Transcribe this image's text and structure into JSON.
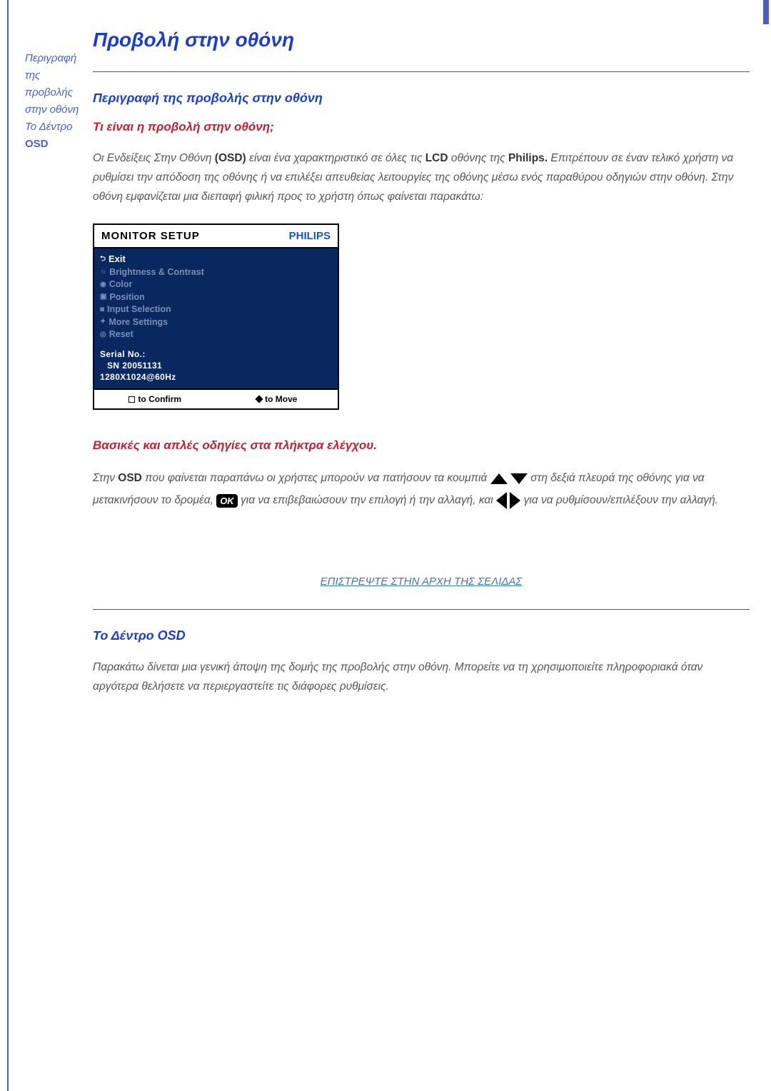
{
  "sidebar": {
    "link1_a": "Περιγραφή",
    "link1_b": "της",
    "link1_c": "προβολής",
    "link1_d": "στην οθόνη",
    "link2_a": "Το Δέντρο",
    "link2_b": "OSD"
  },
  "main": {
    "title": "Προβολή στην οθόνη",
    "desc_heading": "Περιγραφή της προβολής στην οθόνη",
    "what_is_heading": "Τι είναι η προβολή στην οθόνη;",
    "para1_pre": "Οι Ενδείξεις Στην Οθόνη ",
    "para1_osd": "(OSD)",
    "para1_mid1": " είναι ένα χαρακτηριστικό σε όλες τις ",
    "para1_lcd": "LCD",
    "para1_mid2": " οθόνης της ",
    "para1_philips": "Philips.",
    "para1_rest": " Επιτρέπουν σε έναν τελικό χρήστη να ρυθμίσει την απόδοση της οθόνης ή να επιλέξει απευθείας λειτουργίες της οθόνης μέσω ενός παραθύρου οδηγιών στην οθόνη. Στην οθόνη εμφανίζεται μια διεπαφή φιλική προς το χρήστη όπως φαίνεται παρακάτω:",
    "osd_panel": {
      "title": "MONITOR SETUP",
      "brand": "PHILIPS",
      "items": {
        "exit": "Exit",
        "brightness": "Brightness & Contrast",
        "color": "Color",
        "position": "Position",
        "input": "Input Selection",
        "more": "More Settings",
        "reset": "Reset"
      },
      "serial_label": "Serial No.:",
      "serial_value": "SN 20051131",
      "resolution": "1280X1024@60Hz",
      "confirm": "to Confirm",
      "move": "to Move"
    },
    "basic_heading": "Βασικές και απλές οδηγίες στα πλήκτρα ελέγχου.",
    "para2_a": "Στην ",
    "para2_osd": "OSD",
    "para2_b": " που φαίνεται παραπάνω οι χρήστες μπορούν να πατήσουν τα κουμπιά ",
    "para2_c": " στη δεξιά πλευρά της οθόνης για να μετακινήσουν το δρομέα, ",
    "para2_ok": "OK",
    "para2_d": " για να επιβεβαιώσουν την επιλογή ή την αλλαγή, και ",
    "para2_e": " για να ρυθμίσουν/επιλέξουν την αλλαγή.",
    "back_link": "ΕΠΙΣΤΡΕΨΤΕ ΣΤΗΝ ΑΡΧΗ ΤΗΣ ΣΕΛΙΔΑΣ",
    "tree_heading": "Το Δέντρο OSD",
    "para3": "Παρακάτω δίνεται μια γενική άποψη της δομής της προβολής στην οθόνη. Μπορείτε να τη χρησιμοποιείτε πληροφοριακά όταν αργότερα θελήσετε να περιεργαστείτε τις διάφορες ρυθμίσεις."
  }
}
